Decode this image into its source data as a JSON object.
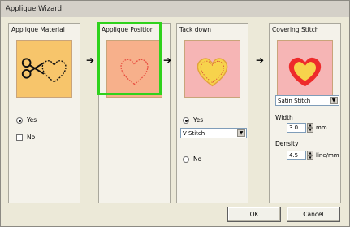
{
  "window": {
    "title": "Applique Wizard"
  },
  "steps": [
    {
      "title": "Applique Material",
      "options": [
        "Yes",
        "No"
      ],
      "selected": "Yes"
    },
    {
      "title": "Applique Position"
    },
    {
      "title": "Tack down",
      "options": [
        "Yes",
        "No"
      ],
      "selected": "Yes",
      "stitch_type": "V Stitch"
    },
    {
      "title": "Covering Stitch",
      "stitch_type": "Satin Stitch",
      "width_label": "Width",
      "width_value": "3.0",
      "width_unit": "mm",
      "density_label": "Density",
      "density_value": "4.5",
      "density_unit": "line/mm"
    }
  ],
  "buttons": {
    "ok": "OK",
    "cancel": "Cancel"
  },
  "colors": {
    "thumb_orange": "#f7c56b",
    "thumb_salmon": "#f7b08b",
    "thumb_pink": "#f6b5b5",
    "heart_red": "#ee2b2b",
    "heart_yellow": "#f7d34c",
    "selection_green": "#2fd21c"
  },
  "icons": [
    "scissors-icon",
    "heart-icon",
    "right-arrow-icon"
  ]
}
